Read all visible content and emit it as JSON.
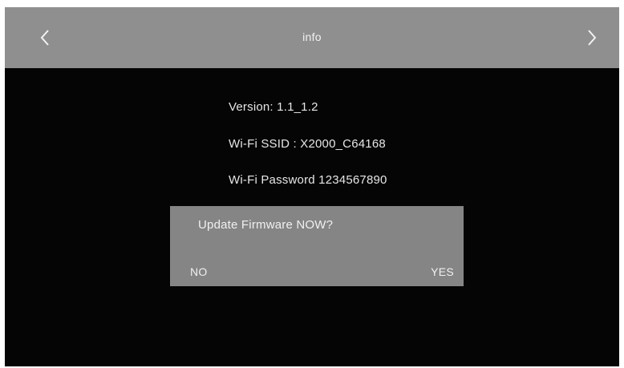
{
  "header": {
    "title": "info",
    "back_icon": "chevron-left-icon",
    "forward_icon": "chevron-right-icon"
  },
  "info": {
    "version": "Version: 1.1_1.2",
    "wifi_ssid": "Wi-Fi SSID : X2000_C64168",
    "wifi_password": "Wi-Fi Password 1234567890"
  },
  "dialog": {
    "message": "Update Firmware NOW?",
    "no_label": "NO",
    "yes_label": "YES"
  },
  "colors": {
    "screen_background": "#050505",
    "header_background": "#8f8f8f",
    "dialog_background": "#858585",
    "text": "#e6e6e6"
  }
}
